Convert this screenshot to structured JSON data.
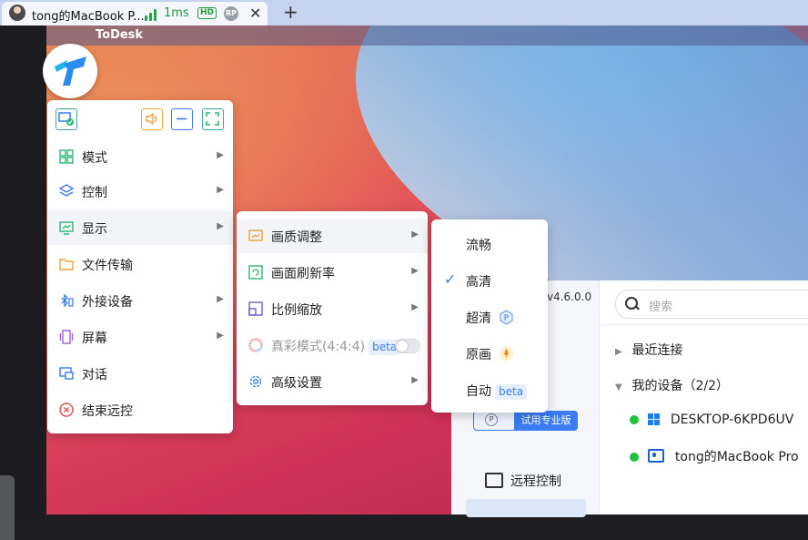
{
  "tab": {
    "title": "tong的MacBook P...",
    "latency": "1ms",
    "hd_badge": "HD",
    "rp_badge": "RP",
    "close": "✕",
    "new_tab": "+"
  },
  "remote": {
    "menubar_app": "ToDesk"
  },
  "menu_main": {
    "items": [
      {
        "label": "模式",
        "icon": "grid-icon"
      },
      {
        "label": "控制",
        "icon": "layers-icon"
      },
      {
        "label": "显示",
        "icon": "monitor-chart-icon"
      },
      {
        "label": "文件传输",
        "icon": "folder-icon"
      },
      {
        "label": "外接设备",
        "icon": "bluetooth-device-icon"
      },
      {
        "label": "屏幕",
        "icon": "screens-icon"
      },
      {
        "label": "对话",
        "icon": "chat-icon"
      },
      {
        "label": "结束远控",
        "icon": "close-circle-icon"
      }
    ]
  },
  "menu_display": {
    "items": [
      {
        "label": "画质调整"
      },
      {
        "label": "画面刷新率"
      },
      {
        "label": "比例缩放"
      },
      {
        "label": "真彩模式(4:4:4)",
        "badge": "beta"
      },
      {
        "label": "高级设置"
      }
    ]
  },
  "menu_quality": {
    "items": [
      {
        "label": "流畅"
      },
      {
        "label": "高清",
        "selected": true
      },
      {
        "label": "超清"
      },
      {
        "label": "原画"
      },
      {
        "label": "自动",
        "badge": "beta"
      }
    ]
  },
  "todesk_window": {
    "version": "v4.6.0.0",
    "search_placeholder": "搜索",
    "pro_icon": "P",
    "pro_label": "试用专业版",
    "remote_control": "远程控制",
    "recent": "最近连接",
    "my_devices": "我的设备（2/2）",
    "devices": [
      {
        "name": "DESKTOP-6KPD6UV",
        "os": "windows",
        "online": true
      },
      {
        "name": "tong的MacBook Pro",
        "os": "mac",
        "online": true
      }
    ]
  },
  "colors": {
    "accent": "#3a7bf2",
    "online": "#1ec53a",
    "teal": "#3ea3a0",
    "orange": "#f0a43a"
  }
}
